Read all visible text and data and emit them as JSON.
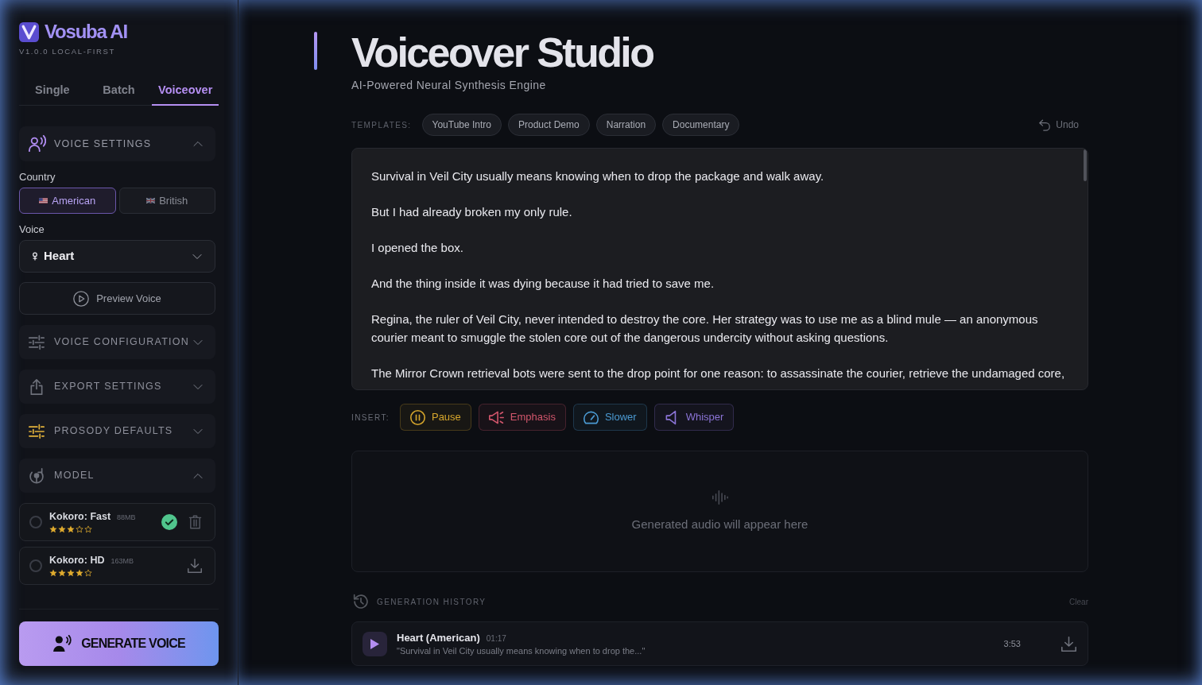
{
  "app": {
    "name": "Vosuba AI",
    "version": "V1.0.0 LOCAL-FIRST"
  },
  "tabs": [
    {
      "label": "Single",
      "selected": false
    },
    {
      "label": "Batch",
      "selected": false
    },
    {
      "label": "Voiceover",
      "selected": true
    }
  ],
  "sidebar": {
    "sections": [
      {
        "title": "VOICE SETTINGS",
        "expanded": true,
        "country_label": "Country",
        "countries": [
          {
            "label": "American",
            "selected": true
          },
          {
            "label": "British",
            "selected": false
          }
        ],
        "voice_label": "Voice",
        "voice": "Heart",
        "preview_button": "Preview Voice"
      },
      {
        "title": "VOICE CONFIGURATION",
        "expanded": false
      },
      {
        "title": "EXPORT SETTINGS",
        "expanded": false
      },
      {
        "title": "PROSODY DEFAULTS",
        "expanded": false
      },
      {
        "title": "MODEL",
        "expanded": true,
        "models": [
          {
            "name": "Kokoro: Fast",
            "size": "88MB",
            "stars": 3,
            "selected": false,
            "downloaded": true
          },
          {
            "name": "Kokoro: HD",
            "size": "163MB",
            "stars": 4,
            "selected": false,
            "downloaded": false
          }
        ]
      }
    ],
    "generate_button": "GENERATE VOICE"
  },
  "header": {
    "title": "Voiceover Studio",
    "subtitle": "AI-Powered Neural Synthesis Engine"
  },
  "templates": {
    "label": "TEMPLATES:",
    "items": [
      "YouTube Intro",
      "Product Demo",
      "Narration",
      "Documentary"
    ],
    "undo": "Undo"
  },
  "editor": {
    "paragraphs": [
      "Survival in Veil City usually means knowing when to drop the package and walk away.",
      "But I had already broken my only rule.",
      "I opened the box.",
      "And the thing inside it was dying because it had tried to save me.",
      "Regina, the ruler of Veil City, never intended to destroy the core. Her strategy was to use me as a blind mule — an anonymous courier meant to smuggle the stolen core out of the dangerous undercity without asking questions.",
      "The Mirror Crown retrieval bots were sent to the drop point for one reason: to assassinate the courier, retrieve the undamaged core,"
    ]
  },
  "insert": {
    "label": "INSERT:",
    "tags": [
      {
        "label": "Pause",
        "color": "#d6a62c"
      },
      {
        "label": "Emphasis",
        "color": "#d2566c"
      },
      {
        "label": "Slower",
        "color": "#4b9ad2"
      },
      {
        "label": "Whisper",
        "color": "#8b74d6"
      }
    ]
  },
  "output": {
    "placeholder": "Generated audio will appear here"
  },
  "history": {
    "title": "GENERATION HISTORY",
    "clear": "Clear",
    "items": [
      {
        "voice": "Heart (American)",
        "time": "01:17",
        "excerpt": "\"Survival in Veil City usually means knowing when to drop the...\"",
        "duration": "3:53"
      }
    ]
  }
}
